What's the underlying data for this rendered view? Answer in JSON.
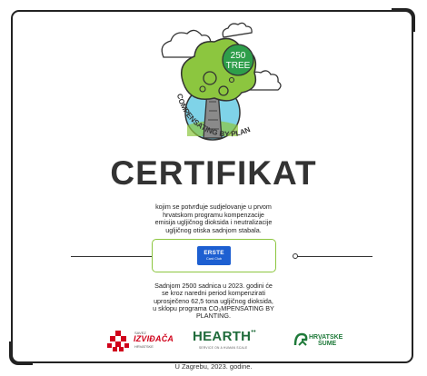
{
  "emblem": {
    "badge_number": "250",
    "badge_word": "TREE",
    "ring_text": "COMPENSATING BY PLANTING '23",
    "colors": {
      "tree": "#8cc63f",
      "sky": "#7fd3e8",
      "trunk": "#8a8a8a"
    }
  },
  "title": "CERTIFIKAT",
  "intro_lines": [
    "kojim se potvrđuje sudjelovanje u prvom",
    "hrvatskom programu kompenzacije",
    "emisija ugljičnog dioksida i neutralizacije",
    "ugljičnog otiska sadnjom stabala."
  ],
  "sponsor": {
    "brand": "ERSTE",
    "sub": "Card Club",
    "color": "#1d5fd1",
    "box_color": "#8cc63f"
  },
  "body_lines": [
    "Sadnjom 2500 sadnica u 2023. godini će",
    "se kroz naredni period kompenzirati",
    "uprosječeno 62,5 tona ugljičnog dioksida,",
    "u sklopu programa CO₂MPENSATING BY",
    "PLANTING."
  ],
  "partners": {
    "izvidaca": {
      "top": "SAVEZ",
      "name": "IZVIĐAČA",
      "bottom": "HRVATSKE"
    },
    "hearth": {
      "name": "HEARTH",
      "tagline": "SERVICE ON A HUMAN SCALE"
    },
    "hrvatske_sume": {
      "line1": "HRVATSKE",
      "line2": "ŠUME"
    }
  },
  "footer": "U Zagrebu, 2023. godine."
}
